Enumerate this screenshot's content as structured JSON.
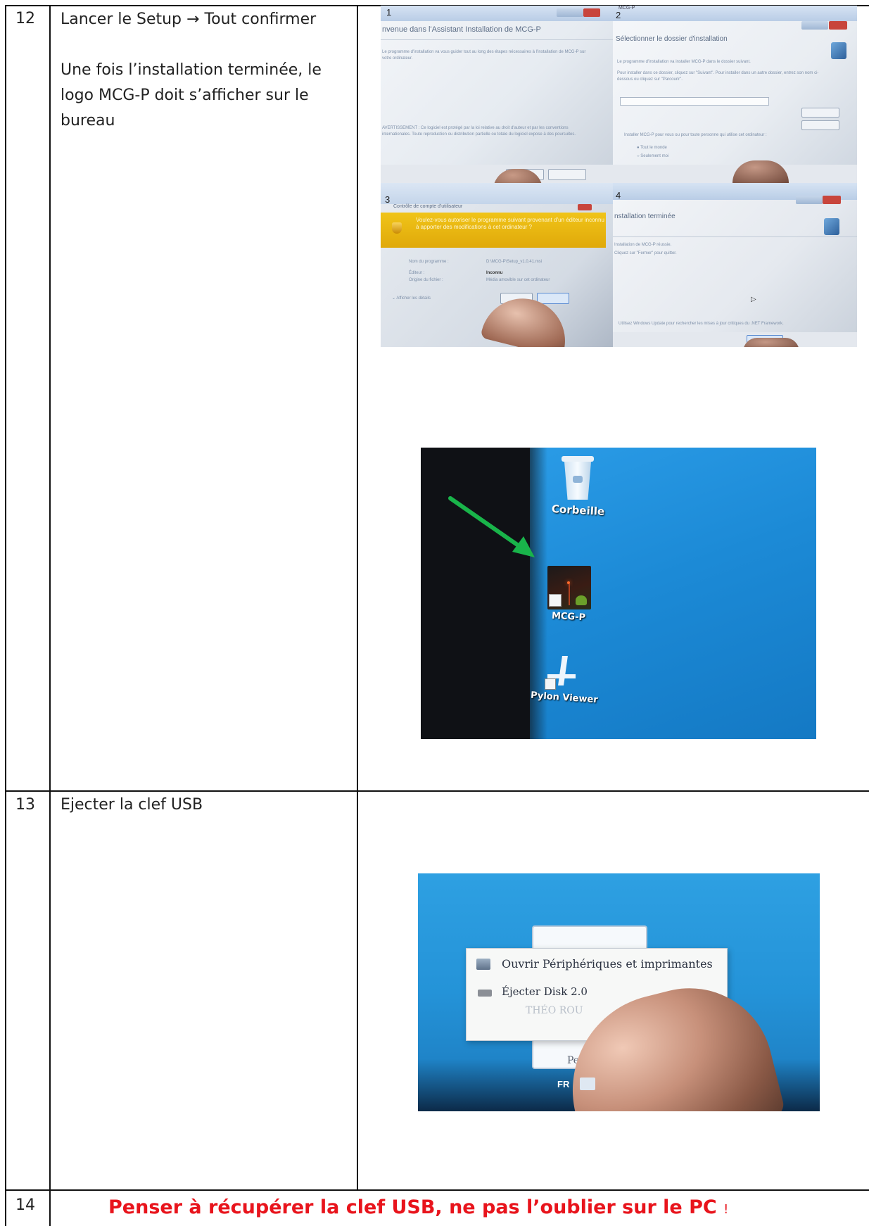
{
  "rows": [
    {
      "number": "12",
      "instruction": "Lancer le Setup → Tout confirmer",
      "note_lines": [
        "Une fois l’installation terminée, le",
        "logo MCG-P doit s’afficher sur le",
        "bureau"
      ]
    },
    {
      "number": "13",
      "instruction": "Ejecter la clef USB"
    },
    {
      "number": "14",
      "warning": "Penser à récupérer la clef USB, ne pas l’oublier sur le PC",
      "warning_mark": "!"
    }
  ],
  "installer_photos": {
    "panel1": {
      "step": "1",
      "title": "nvenue dans l'Assistant Installation de MCG-P"
    },
    "panel2": {
      "step": "2",
      "title": "Sélectionner le dossier d'installation",
      "window_label": "MCG-P"
    },
    "panel3": {
      "step": "3",
      "title": "Contrôle de compte d'utilisateur"
    },
    "panel4": {
      "step": "4",
      "title": "nstallation terminée"
    }
  },
  "desktop_photo": {
    "icons": [
      {
        "name": "Corbeille"
      },
      {
        "name": "MCG-P"
      },
      {
        "name": "Pylon Viewer"
      }
    ],
    "arrow_color": "#19b44a",
    "background_color": "#1d8fd6"
  },
  "usb_photo": {
    "menu_items": [
      "Ouvrir Périphériques et imprimantes",
      "Éjecter Disk 2.0",
      "THÉO ROU",
      "Pe"
    ],
    "taskbar_lang": "FR"
  },
  "colors": {
    "warning_text": "#e8141c",
    "border": "#111111"
  }
}
